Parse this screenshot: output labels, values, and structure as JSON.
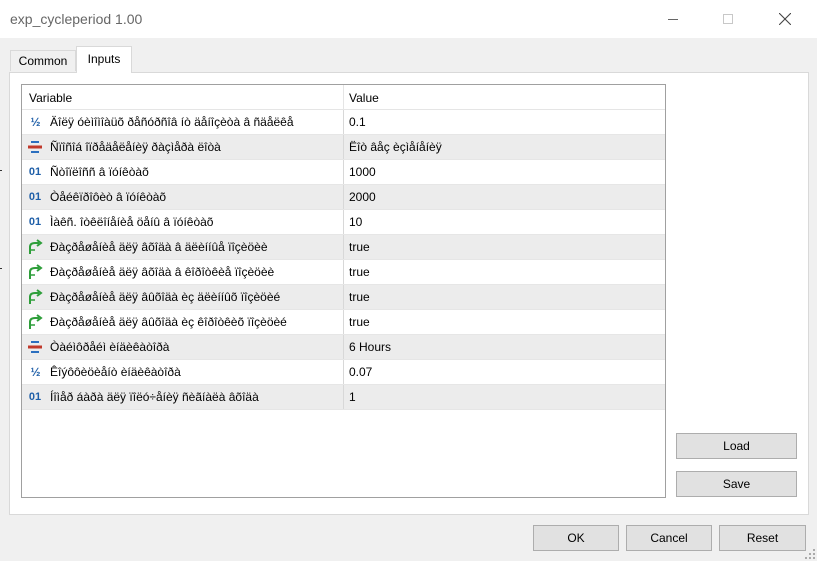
{
  "window": {
    "title": "exp_cycleperiod 1.00"
  },
  "tabs": [
    {
      "label": "Common"
    },
    {
      "label": "Inputs"
    }
  ],
  "grid": {
    "columns": {
      "variable": "Variable",
      "value": "Value"
    },
    "rows": [
      {
        "icon": "fraction-icon",
        "variable": "Äîëÿ óèìîìîàüõ ðåñóðñîâ íò äåíîçèòà â ñäåëêå",
        "value": "0.1"
      },
      {
        "icon": "enum-icon",
        "variable": "Ñïîñîá îïðåäåëåíèÿ ðàçìåðà ëîòà",
        "value": "Ëîò âåç èçìåíåíèÿ"
      },
      {
        "icon": "integer-icon",
        "variable": "Ñòîïëîññ â ïóíêòàõ",
        "value": "1000"
      },
      {
        "icon": "integer-icon",
        "variable": "Òåéêïðîôèò â ïóíêòàõ",
        "value": "2000"
      },
      {
        "icon": "integer-icon",
        "variable": "Ìàêñ. îòêëîíåíèå öåíû â ïóíêòàõ",
        "value": "10"
      },
      {
        "icon": "boolean-icon",
        "variable": "Ðàçðåøåíèå äëÿ âõîäà â äëèííûå ïîçèöèè",
        "value": "true"
      },
      {
        "icon": "boolean-icon",
        "variable": "Ðàçðåøåíèå äëÿ âõîäà â êîðîòêèå ïîçèöèè",
        "value": "true"
      },
      {
        "icon": "boolean-icon",
        "variable": "Ðàçðåøåíèå äëÿ âûõîäà èç äëèííûõ ïîçèöèé",
        "value": "true"
      },
      {
        "icon": "boolean-icon",
        "variable": "Ðàçðåøåíèå äëÿ âûõîäà èç êîðîòêèõ ïîçèöèé",
        "value": "true"
      },
      {
        "icon": "enum-icon",
        "variable": "Òàéìôðåéì èíäèêàòîðà",
        "value": "6 Hours"
      },
      {
        "icon": "fraction-icon",
        "variable": "Êîýôôèöèåíò èíäèêàòîðà",
        "value": "0.07"
      },
      {
        "icon": "integer-icon",
        "variable": "Íîìåð áàðà äëÿ ïîëó÷åíèÿ ñèãíàëà âõîäà",
        "value": "1"
      }
    ]
  },
  "buttons": {
    "load": "Load",
    "save": "Save",
    "ok": "OK",
    "cancel": "Cancel",
    "reset": "Reset"
  },
  "colors": {
    "accent": "#1f5fa8",
    "boolean_icon": "#2e9e3a",
    "enum_icon_top": "#c0392b",
    "enum_icon_bottom": "#2c6fbf"
  }
}
